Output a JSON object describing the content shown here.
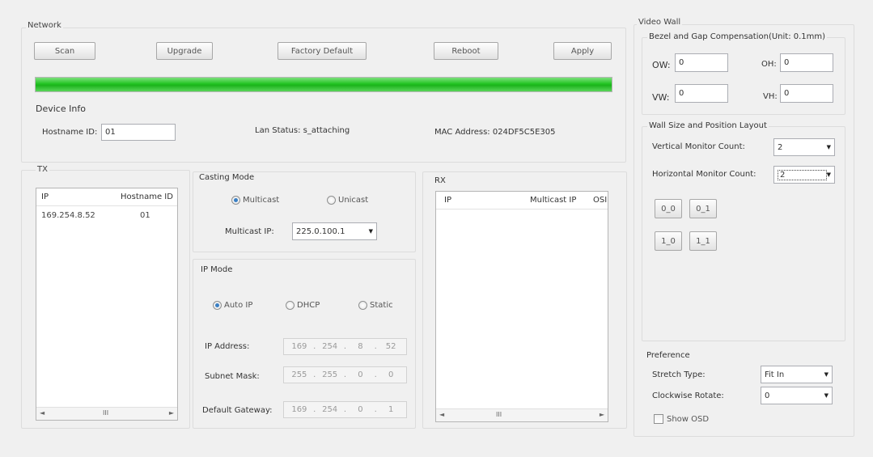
{
  "network": {
    "title": "Network",
    "buttons": {
      "scan": "Scan",
      "upgrade": "Upgrade",
      "factory_default": "Factory Default",
      "reboot": "Reboot",
      "apply": "Apply"
    },
    "progress": 1.0,
    "progress_color": "#22c422"
  },
  "device_info": {
    "title": "Device Info",
    "hostname_label": "Hostname ID:",
    "hostname_value": "01",
    "lan_status": "Lan Status: s_attaching",
    "mac_address": "MAC Address: 024DF5C5E305"
  },
  "tx": {
    "title": "TX",
    "columns": [
      "IP",
      "Hostname ID"
    ],
    "rows": [
      {
        "ip": "169.254.8.52",
        "hostname": "01"
      }
    ],
    "scroll_left": "◄",
    "scroll_thumb": "III",
    "scroll_right": "►"
  },
  "casting_mode": {
    "title": "Casting Mode",
    "multicast": "Multicast",
    "unicast": "Unicast",
    "selected": "multicast",
    "multicast_ip_label": "Multicast IP:",
    "multicast_ip": "225.0.100.1"
  },
  "ip_mode": {
    "title": "IP Mode",
    "auto_ip": "Auto IP",
    "dhcp": "DHCP",
    "static": "Static",
    "selected": "auto_ip",
    "ip_address_label": "IP Address:",
    "ip_address": [
      "169",
      "254",
      "8",
      "52"
    ],
    "subnet_mask_label": "Subnet Mask:",
    "subnet_mask": [
      "255",
      "255",
      "0",
      "0"
    ],
    "gateway_label": "Default Gateway:",
    "gateway": [
      "169",
      "254",
      "0",
      "1"
    ]
  },
  "rx": {
    "title": "RX",
    "columns": [
      "IP",
      "Multicast IP",
      "OSI"
    ],
    "scroll_left": "◄",
    "scroll_thumb": "III",
    "scroll_right": "►"
  },
  "video_wall": {
    "title": "Video Wall",
    "bezel_title": "Bezel and Gap Compensation(Unit: 0.1mm)",
    "ow_label": "OW:",
    "ow": "0",
    "oh_label": "OH:",
    "oh": "0",
    "vw_label": "VW:",
    "vw": "0",
    "vh_label": "VH:",
    "vh": "0",
    "layout_title": "Wall Size and Position Layout",
    "vertical_label": "Vertical Monitor Count:",
    "vertical_value": "2",
    "horizontal_label": "Horizontal Monitor Count:",
    "horizontal_value": "2",
    "positions": [
      "0_0",
      "0_1",
      "1_0",
      "1_1"
    ]
  },
  "preference": {
    "title": "Preference",
    "stretch_label": "Stretch Type:",
    "stretch_value": "Fit In",
    "rotate_label": "Clockwise Rotate:",
    "rotate_value": "0",
    "show_osd": "Show OSD"
  }
}
